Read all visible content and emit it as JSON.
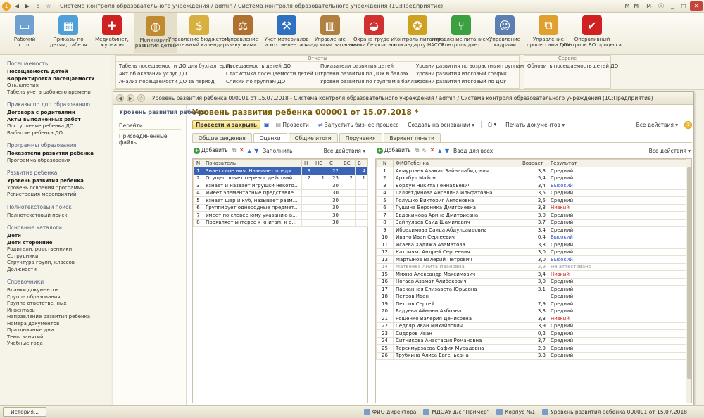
{
  "window": {
    "title": "Система контроля образовательного учреждения / admin / Система контроля образовательного учреждения   (1С:Предприятие)",
    "controls": [
      "M",
      "M+",
      "M-"
    ]
  },
  "toolbar": [
    {
      "label": "Рабочий\nстол",
      "icon": "desktop-icon",
      "color": "#6fa0d0"
    },
    {
      "label": "Приказы по\nдетям, табеля",
      "icon": "chart-icon",
      "color": "#4f9fd8"
    },
    {
      "label": "Медкабинет,\nжурналы",
      "icon": "red-cross-icon",
      "color": "#d02020"
    },
    {
      "label": "Мониторинг\nразвития детей",
      "icon": "globe-icon",
      "color": "#c08a30"
    },
    {
      "label": "Управление бюджетом,\nплатежный календарь",
      "icon": "money-bag-icon",
      "color": "#d8b040"
    },
    {
      "label": "Управление\nзакупками",
      "icon": "scales-icon",
      "color": "#b07030"
    },
    {
      "label": "Учет материалов\nи хоз. инвентаря",
      "icon": "tools-icon",
      "color": "#3070c0"
    },
    {
      "label": "Управление\nскладскими запасами",
      "icon": "boxes-icon",
      "color": "#b08040"
    },
    {
      "label": "Охрана труда и\nтехника безопасности",
      "icon": "helmet-icon",
      "color": "#d03030"
    },
    {
      "label": "Контроль питания\nпо стандарту HACCP",
      "icon": "haccp-medal-icon",
      "color": "#d0a020"
    },
    {
      "label": "Управление питанием,\nконтроль диет",
      "icon": "fork-knife-icon",
      "color": "#3aa040"
    },
    {
      "label": "Управление\nкадрами",
      "icon": "person-icon",
      "color": "#5a7fb0"
    },
    {
      "label": "Управление\nпроцессами ДОУ",
      "icon": "process-icon",
      "color": "#e0a030"
    },
    {
      "label": "Оперативный\nконтроль ВО процесса",
      "icon": "checkmark-icon",
      "color": "#d02020"
    }
  ],
  "submenu": {
    "reports_title": "Отчеты",
    "service_title": "Сервис",
    "reports_col1": [
      "Табель посещаемости ДО для бухгалтерии",
      "Акт об оказании услуг ДО",
      "Анализ посещаемости ДО за период"
    ],
    "reports_col2": [
      "Посещаемость детей ДО",
      "Статистика посещаемости детей ДО",
      "Списки по группам ДО"
    ],
    "reports_col3": [
      "Показатели развития детей",
      "Уровни развития по ДОУ в баллах",
      "Уровни развития по группам в баллах"
    ],
    "reports_col4": [
      "Уровни развития по возрастным группам",
      "Уровни развития итоговый график",
      "Уровни развития итоговый по ДОУ"
    ],
    "service_items": [
      "Обновить посещаемость детей ДО"
    ]
  },
  "leftnav": [
    {
      "head": "Посещаемость",
      "items": [
        {
          "t": "Посещаемость детей",
          "b": true
        },
        {
          "t": "Корректировка посещаемости",
          "b": true
        },
        {
          "t": "Отклонения",
          "b": false
        },
        {
          "t": "Табель учета рабочего времени",
          "b": false
        }
      ]
    },
    {
      "head": "Приказы по доп.образованию",
      "items": [
        {
          "t": "Договора с родителями",
          "b": true
        },
        {
          "t": "Акты выполненных работ",
          "b": true
        },
        {
          "t": "Поступление ребенка ДО",
          "b": false
        },
        {
          "t": "Выбытие ребенка ДО",
          "b": false
        }
      ]
    },
    {
      "head": "Программы образования",
      "items": [
        {
          "t": "Показатели развития ребенка",
          "b": true
        },
        {
          "t": "Программа образования",
          "b": false
        }
      ]
    },
    {
      "head": "Развитие ребенка",
      "items": [
        {
          "t": "Уровень развития ребенка",
          "b": true
        },
        {
          "t": "Уровень освоения программы",
          "b": false
        },
        {
          "t": "Регистрация мероприятий",
          "b": false
        }
      ]
    },
    {
      "head": "Полнотекстовый поиск",
      "items": [
        {
          "t": "Полнотекстовый поиск",
          "b": false
        }
      ]
    },
    {
      "head": "Основные каталоги",
      "items": [
        {
          "t": "Дети",
          "b": true
        },
        {
          "t": "Дети сторонние",
          "b": true
        },
        {
          "t": "Родители, родственники",
          "b": false
        },
        {
          "t": "Сотрудники",
          "b": false
        },
        {
          "t": "Структура групп, классов",
          "b": false
        },
        {
          "t": "Должности",
          "b": false
        }
      ]
    },
    {
      "head": "Справочники",
      "items": [
        {
          "t": "Бланки документов",
          "b": false
        },
        {
          "t": "Группа образования",
          "b": false
        },
        {
          "t": "Группа ответственных",
          "b": false
        },
        {
          "t": "Инвентарь",
          "b": false
        },
        {
          "t": "Направление развития ребенка",
          "b": false
        },
        {
          "t": "Номера документов",
          "b": false
        },
        {
          "t": "Праздничные дни",
          "b": false
        },
        {
          "t": "Темы занятий",
          "b": false
        },
        {
          "t": "Учебные года",
          "b": false
        }
      ]
    }
  ],
  "doc": {
    "window_title": "Уровень развития ребенка 000001 от 15.07.2018 - Система контроля образовательного учреждения / admin / Система контроля образовательного учреждения   (1С:Предприятие)",
    "left_heading": "Уровень развития ребенка",
    "left_group": "Перейти",
    "left_link": "Присоединенные файлы",
    "heading": "Уровень развития ребенка 000001 от 15.07.2018 *",
    "actions": {
      "post_close": "Провести и закрыть",
      "post": "Провести",
      "bp": "Запустить бизнес-процесс",
      "create_based": "Создать на основании",
      "print_docs": "Печать документов",
      "all_actions": "Все действия",
      "help": "?"
    },
    "tabs": [
      "Общие сведения",
      "Оценки",
      "Общие итоги",
      "Поручения",
      "Вариант печати"
    ],
    "active_tab": 1,
    "left_bar": {
      "add": "Добавить",
      "fill": "Заполнить",
      "all": "Все действия"
    },
    "right_bar": {
      "add": "Добавить",
      "input_all": "Ввод для всех",
      "all": "Все действия"
    },
    "left_table": {
      "headers": [
        "N",
        "Показатель",
        "Н",
        "НС",
        "С",
        "ВС",
        "В"
      ],
      "rows": [
        [
          "1",
          "Знает свое имя. Называет предмет...",
          "3",
          "",
          "22",
          "",
          "4"
        ],
        [
          "2",
          "Осуществляет перенос действий с о...",
          "2",
          "1",
          "23",
          "2",
          "1"
        ],
        [
          "3",
          "Узнает и назвает игрушки некоторы...",
          "",
          "",
          "30",
          "",
          ""
        ],
        [
          "4",
          "Имеет элементарные представлени...",
          "",
          "",
          "30",
          "",
          ""
        ],
        [
          "5",
          "Узнает шар и куб, называет размер ...",
          "",
          "",
          "30",
          "",
          ""
        ],
        [
          "6",
          "Группирует однородные предметы, в...",
          "",
          "",
          "30",
          "",
          ""
        ],
        [
          "7",
          "Умеет по словесному указанию взр...",
          "",
          "",
          "30",
          "",
          ""
        ],
        [
          "8",
          "Проявляет интерес к книгам, к расс...",
          "",
          "",
          "30",
          "",
          ""
        ]
      ]
    },
    "right_table": {
      "headers": [
        "N",
        "ФИОРебенка",
        "Возраст",
        "Результат"
      ],
      "rows": [
        [
          "1",
          "Акмурзаев Азамат Зайналабидович",
          "3,3",
          "Средний",
          "mid"
        ],
        [
          "2",
          "Архибул Майон",
          "5,4",
          "Средний",
          "mid"
        ],
        [
          "3",
          "Бордун Никита Геннадьевич",
          "3,4",
          "Высокий",
          "high"
        ],
        [
          "4",
          "Галяетдинова Ангелина Ильфатовна",
          "3,5",
          "Средний",
          "mid"
        ],
        [
          "5",
          "Голушко Виктория Антоновна",
          "2,5",
          "Средний",
          "mid"
        ],
        [
          "6",
          "Гущина Вероника Дмитриевна",
          "3,3",
          "Низкий",
          "low"
        ],
        [
          "7",
          "Евдокимова Арина Дмитриевна",
          "3,0",
          "Средний",
          "mid"
        ],
        [
          "8",
          "Зайпулаев Саид Шамилевич",
          "3,7",
          "Средний",
          "mid"
        ],
        [
          "9",
          "Ибрахимова Саида Абдулсаидовна",
          "3,4",
          "Средний",
          "mid"
        ],
        [
          "10",
          "Ивано Иван Сергеевич",
          "0,4",
          "Высокий",
          "high"
        ],
        [
          "11",
          "Исаева Хадижа Азаматова",
          "3,3",
          "Средний",
          "mid"
        ],
        [
          "12",
          "Катричко Андрей Сергеевич",
          "3,0",
          "Средний",
          "mid"
        ],
        [
          "13",
          "Мартынов Валерий Петрович",
          "3,0",
          "Высокий",
          "high"
        ],
        [
          "14",
          "Матвеева Анита Ивановна",
          "2,9",
          "Не аттестовано",
          "na"
        ],
        [
          "15",
          "Михно Александр Максимович",
          "3,4",
          "Низкий",
          "low"
        ],
        [
          "16",
          "Ногаев Азамат Алибекович",
          "3,0",
          "Средний",
          "mid"
        ],
        [
          "17",
          "Пасканная Елизавета Юрьевна",
          "3,1",
          "Средний",
          "mid"
        ],
        [
          "18",
          "Петров Иван",
          "",
          "Средний",
          "mid"
        ],
        [
          "19",
          "Петров Сергей",
          "7,9",
          "Средний",
          "mid"
        ],
        [
          "20",
          "Радуева Аймани Акбовна",
          "3,3",
          "Средний",
          "mid"
        ],
        [
          "21",
          "Рощенко Валерия Денисовна",
          "3,3",
          "Низкий",
          "low"
        ],
        [
          "22",
          "Седляр Иван Михайлович",
          "3,9",
          "Средний",
          "mid"
        ],
        [
          "23",
          "Сидоров Иван",
          "0,2",
          "Средний",
          "mid"
        ],
        [
          "24",
          "Ситникова Анастасия Романовна",
          "3,7",
          "Средний",
          "mid"
        ],
        [
          "25",
          "Терекмурзаева Сафия Мурадовна",
          "2,9",
          "Средний",
          "mid"
        ],
        [
          "26",
          "Трубкина Алиса Евгеньевна",
          "3,3",
          "Средний",
          "mid"
        ]
      ]
    }
  },
  "status": {
    "history": "История...",
    "items": [
      "ФИО директора",
      "МДОАУ д/с \"Пример\"",
      "Корпус №1",
      "Уровень развития ребенка 000001 от 15.07.2018"
    ]
  }
}
